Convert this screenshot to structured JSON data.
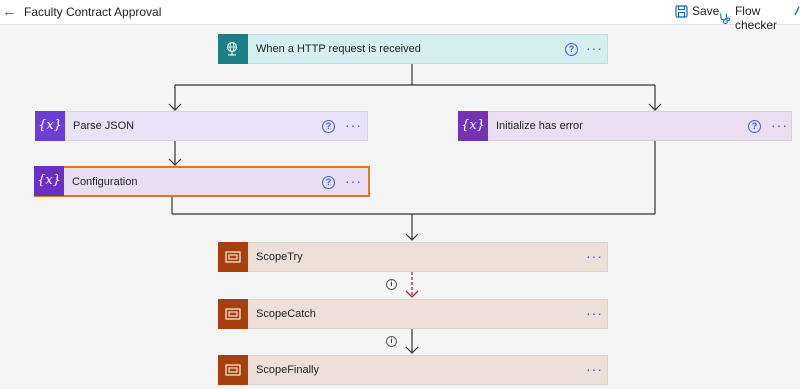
{
  "header": {
    "title": "Faculty Contract Approval",
    "save_label": "Save",
    "flow_checker_label": "Flow checker"
  },
  "flow": {
    "trigger": {
      "label": "When a HTTP request is received",
      "icon": "globe-icon"
    },
    "parse_json": {
      "label": "Parse JSON",
      "icon": "curly-braces-icon"
    },
    "initialize": {
      "label": "Initialize has error",
      "icon": "variable-icon"
    },
    "configuration": {
      "label": "Configuration",
      "icon": "variable-icon"
    },
    "scope_try": {
      "label": "ScopeTry",
      "icon": "scope-icon"
    },
    "scope_catch": {
      "label": "ScopeCatch",
      "icon": "scope-icon"
    },
    "scope_finally": {
      "label": "ScopeFinally",
      "icon": "scope-icon"
    },
    "help_glyph": "?",
    "more_glyph": "···",
    "info_glyph": "i",
    "var_icon_glyph": "{x}",
    "json_icon_glyph": "{𝑥}"
  },
  "colors": {
    "accent": "#0f6cbd",
    "trigger": "#1a7f86",
    "variable": "#6b3fd4",
    "scope": "#a6410c",
    "selected_border": "#e07b1c",
    "run_after_failed": "#a4262c"
  }
}
